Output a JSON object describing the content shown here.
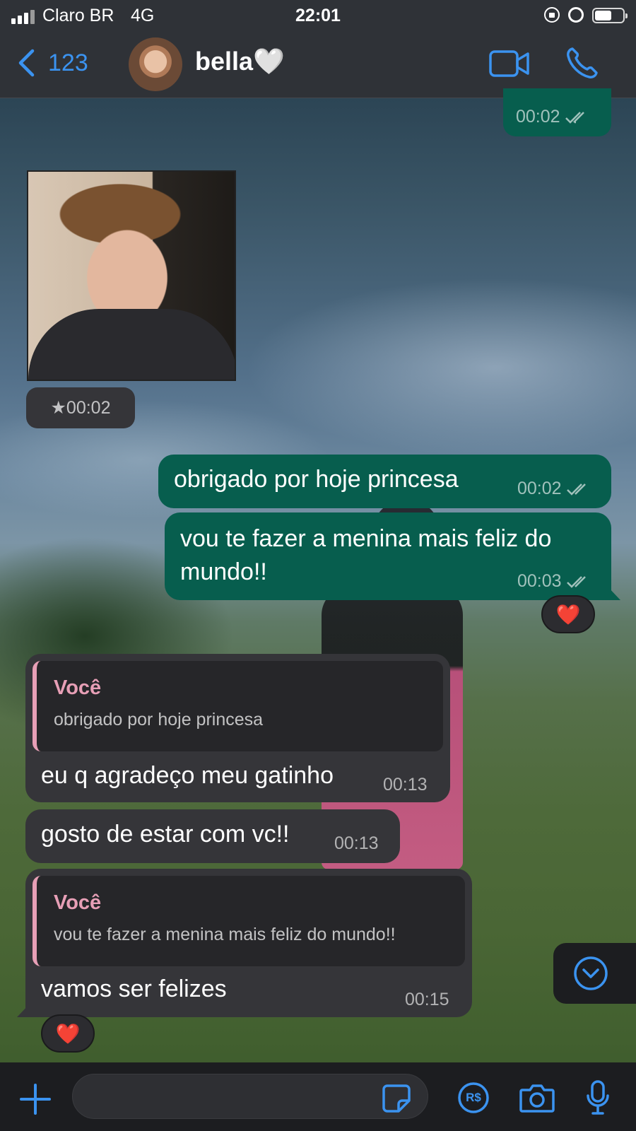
{
  "status_bar": {
    "carrier": "Claro BR",
    "network": "4G",
    "time": "22:01",
    "battery_level": 0.6,
    "signal_bars": 3
  },
  "header": {
    "back_label": "123",
    "contact_name": "bella🤍",
    "avatar_icon": "contact-avatar",
    "video_call_icon": "video-camera-icon",
    "voice_call_icon": "phone-icon"
  },
  "messages": [
    {
      "id": "m0",
      "direction": "outgoing",
      "text": "",
      "time": "00:02",
      "read": true
    },
    {
      "id": "m1",
      "direction": "incoming",
      "type": "photo",
      "time": "00:02",
      "starred": true,
      "star_glyph": "★"
    },
    {
      "id": "m2",
      "direction": "outgoing",
      "text": "obrigado por hoje princesa",
      "time": "00:02",
      "read": true
    },
    {
      "id": "m3",
      "direction": "outgoing",
      "text": "vou te fazer a menina mais feliz do mundo!!",
      "time": "00:03",
      "read": true,
      "reaction": "❤️"
    },
    {
      "id": "m4",
      "direction": "incoming",
      "reply_to": {
        "author": "Você",
        "text": "obrigado por hoje princesa"
      },
      "text": "eu q agradeço meu gatinho",
      "time": "00:13"
    },
    {
      "id": "m5",
      "direction": "incoming",
      "text": "gosto de estar com vc!!",
      "time": "00:13"
    },
    {
      "id": "m6",
      "direction": "incoming",
      "reply_to": {
        "author": "Você",
        "text": "vou te fazer a menina mais feliz do mundo!!"
      },
      "text": "vamos ser felizes",
      "time": "00:15",
      "reaction": "❤️"
    }
  ],
  "input_bar": {
    "value": "",
    "placeholder": "",
    "icons": [
      "plus-icon",
      "sticker-icon",
      "payment-icon",
      "camera-icon",
      "microphone-icon"
    ],
    "payment_label": "R$"
  },
  "colors": {
    "accent": "#3b93f0",
    "outgoing_bubble": "#075e4e",
    "incoming_bubble": "#353539",
    "quote_accent": "#e79fb6",
    "bars": "#2f3237"
  }
}
